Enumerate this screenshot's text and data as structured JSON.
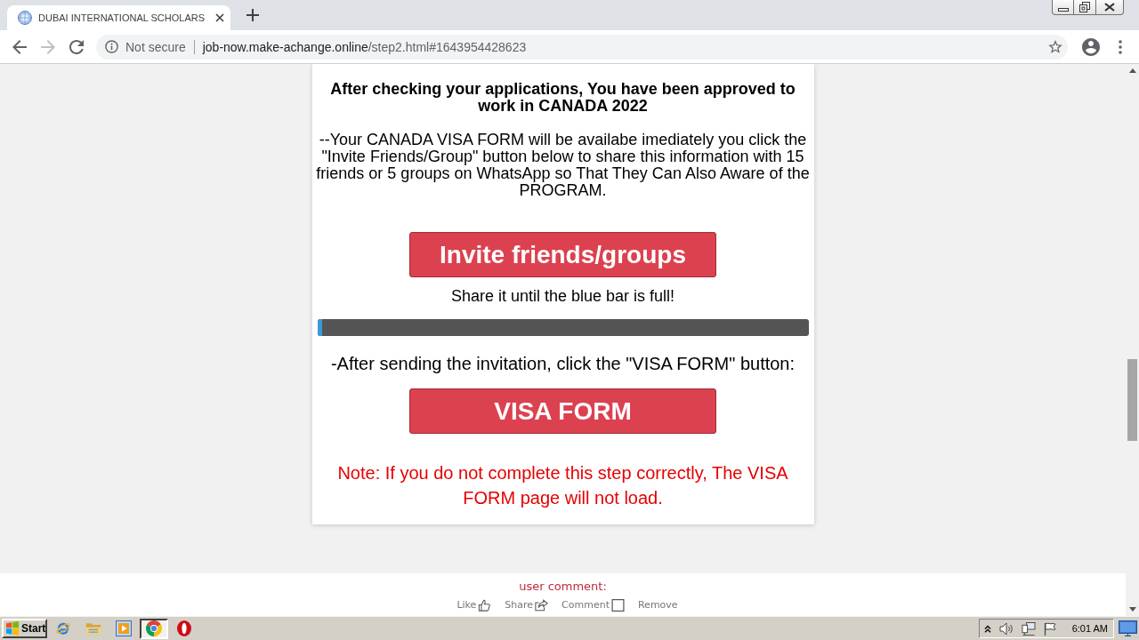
{
  "tabs": [
    {
      "title": "DUBAI INTERNATIONAL SCHOLARS",
      "selected": true
    }
  ],
  "navigation": [
    {
      "kind": "back",
      "disabled": false
    },
    {
      "kind": "forward",
      "disabled": true
    },
    {
      "kind": "reload",
      "disabled": false
    }
  ],
  "address_bar": {
    "security_label": "Not secure",
    "host": "job-now.make-achange.online",
    "path": "/step2.html#1643954428623"
  },
  "card": {
    "heading": "After checking your applications, You have been approved to work in CANADA 2022",
    "intro": "--Your CANADA VISA FORM will be availabe imediately you click the \"Invite Friends/Group\" button below to share this information with 15 friends or 5 groups on WhatsApp so That They Can Also Aware of the PROGRAM.",
    "invite_button": "Invite friends/groups",
    "share_hint": "Share it until the blue bar is full!",
    "share_progress": {
      "level": 0.01
    },
    "instruction": "-After sending the invitation, click the \"VISA FORM\" button:",
    "visa_button": "VISA FORM",
    "note": "Note: If you do not complete this step correctly, The VISA FORM page will not load."
  },
  "comments": {
    "title": "user comment:",
    "actions": [
      {
        "label": "Like",
        "kind": "like"
      },
      {
        "label": "Share",
        "kind": "share"
      },
      {
        "label": "Comment",
        "kind": "comment"
      },
      {
        "label": "Remove",
        "kind": "remove"
      }
    ]
  },
  "taskbar": {
    "start_label": "Start",
    "apps": [
      {
        "kind": "ie",
        "selected": false
      },
      {
        "kind": "explorer",
        "selected": false
      },
      {
        "kind": "media",
        "selected": false
      },
      {
        "kind": "chrome",
        "selected": true
      },
      {
        "kind": "opera",
        "selected": false
      }
    ],
    "clock": "6:01 AM"
  }
}
